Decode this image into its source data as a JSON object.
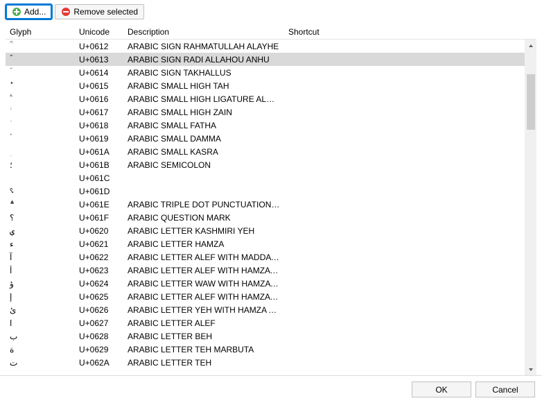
{
  "toolbar": {
    "add_label": "Add...",
    "remove_label": "Remove selected"
  },
  "columns": {
    "glyph": "Glyph",
    "unicode": "Unicode",
    "description": "Description",
    "shortcut": "Shortcut"
  },
  "footer": {
    "ok": "OK",
    "cancel": "Cancel"
  },
  "selected_index": 1,
  "rows": [
    {
      "glyph": "ؒ",
      "unicode": "U+0612",
      "description": "ARABIC SIGN RAHMATULLAH ALAYHE",
      "shortcut": ""
    },
    {
      "glyph": "ؓ",
      "unicode": "U+0613",
      "description": "ARABIC SIGN RADI ALLAHOU ANHU",
      "shortcut": ""
    },
    {
      "glyph": "ؔ",
      "unicode": "U+0614",
      "description": "ARABIC SIGN TAKHALLUS",
      "shortcut": ""
    },
    {
      "glyph": "ؕ",
      "unicode": "U+0615",
      "description": "ARABIC SMALL HIGH TAH",
      "shortcut": ""
    },
    {
      "glyph": "ؖ",
      "unicode": "U+0616",
      "description": "ARABIC SMALL HIGH LIGATURE ALEF WIT...",
      "shortcut": ""
    },
    {
      "glyph": "ؗ",
      "unicode": "U+0617",
      "description": "ARABIC SMALL HIGH ZAIN",
      "shortcut": ""
    },
    {
      "glyph": "ؘ",
      "unicode": "U+0618",
      "description": "ARABIC SMALL FATHA",
      "shortcut": ""
    },
    {
      "glyph": "ؙ",
      "unicode": "U+0619",
      "description": "ARABIC SMALL DAMMA",
      "shortcut": ""
    },
    {
      "glyph": "ؚ",
      "unicode": "U+061A",
      "description": "ARABIC SMALL KASRA",
      "shortcut": ""
    },
    {
      "glyph": "؛",
      "unicode": "U+061B",
      "description": "ARABIC SEMICOLON",
      "shortcut": ""
    },
    {
      "glyph": "",
      "unicode": "U+061C",
      "description": "",
      "shortcut": ""
    },
    {
      "glyph": "؝",
      "unicode": "U+061D",
      "description": "",
      "shortcut": ""
    },
    {
      "glyph": "؞",
      "unicode": "U+061E",
      "description": "ARABIC TRIPLE DOT PUNCTUATION MARK",
      "shortcut": ""
    },
    {
      "glyph": "؟",
      "unicode": "U+061F",
      "description": "ARABIC QUESTION MARK",
      "shortcut": ""
    },
    {
      "glyph": "ؠ",
      "unicode": "U+0620",
      "description": "ARABIC LETTER KASHMIRI YEH",
      "shortcut": ""
    },
    {
      "glyph": "ء",
      "unicode": "U+0621",
      "description": "ARABIC LETTER HAMZA",
      "shortcut": ""
    },
    {
      "glyph": "آ",
      "unicode": "U+0622",
      "description": "ARABIC LETTER ALEF WITH MADDA ABO",
      "shortcut": ""
    },
    {
      "glyph": "أ",
      "unicode": "U+0623",
      "description": "ARABIC LETTER ALEF WITH HAMZA ABO",
      "shortcut": ""
    },
    {
      "glyph": "ؤ",
      "unicode": "U+0624",
      "description": "ARABIC LETTER WAW WITH HAMZA ABO",
      "shortcut": ""
    },
    {
      "glyph": "إ",
      "unicode": "U+0625",
      "description": "ARABIC LETTER ALEF WITH HAMZA BELO",
      "shortcut": ""
    },
    {
      "glyph": "ئ",
      "unicode": "U+0626",
      "description": "ARABIC LETTER YEH WITH HAMZA ABOVE",
      "shortcut": ""
    },
    {
      "glyph": "ا",
      "unicode": "U+0627",
      "description": "ARABIC LETTER ALEF",
      "shortcut": ""
    },
    {
      "glyph": "ب",
      "unicode": "U+0628",
      "description": "ARABIC LETTER BEH",
      "shortcut": ""
    },
    {
      "glyph": "ة",
      "unicode": "U+0629",
      "description": "ARABIC LETTER TEH MARBUTA",
      "shortcut": ""
    },
    {
      "glyph": "ت",
      "unicode": "U+062A",
      "description": "ARABIC LETTER TEH",
      "shortcut": ""
    }
  ]
}
